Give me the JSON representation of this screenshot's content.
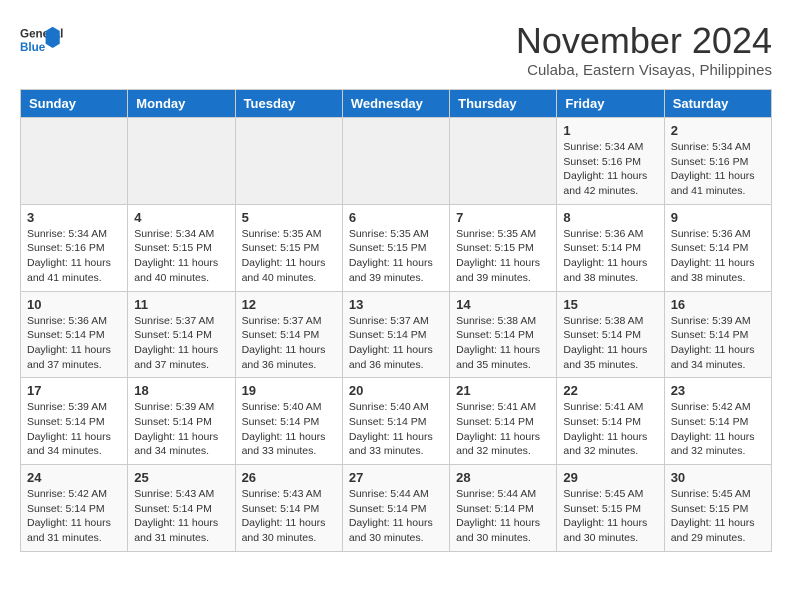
{
  "logo": {
    "line1": "General",
    "line2": "Blue"
  },
  "title": "November 2024",
  "location": "Culaba, Eastern Visayas, Philippines",
  "weekdays": [
    "Sunday",
    "Monday",
    "Tuesday",
    "Wednesday",
    "Thursday",
    "Friday",
    "Saturday"
  ],
  "weeks": [
    [
      {
        "day": "",
        "info": ""
      },
      {
        "day": "",
        "info": ""
      },
      {
        "day": "",
        "info": ""
      },
      {
        "day": "",
        "info": ""
      },
      {
        "day": "",
        "info": ""
      },
      {
        "day": "1",
        "info": "Sunrise: 5:34 AM\nSunset: 5:16 PM\nDaylight: 11 hours\nand 42 minutes."
      },
      {
        "day": "2",
        "info": "Sunrise: 5:34 AM\nSunset: 5:16 PM\nDaylight: 11 hours\nand 41 minutes."
      }
    ],
    [
      {
        "day": "3",
        "info": "Sunrise: 5:34 AM\nSunset: 5:16 PM\nDaylight: 11 hours\nand 41 minutes."
      },
      {
        "day": "4",
        "info": "Sunrise: 5:34 AM\nSunset: 5:15 PM\nDaylight: 11 hours\nand 40 minutes."
      },
      {
        "day": "5",
        "info": "Sunrise: 5:35 AM\nSunset: 5:15 PM\nDaylight: 11 hours\nand 40 minutes."
      },
      {
        "day": "6",
        "info": "Sunrise: 5:35 AM\nSunset: 5:15 PM\nDaylight: 11 hours\nand 39 minutes."
      },
      {
        "day": "7",
        "info": "Sunrise: 5:35 AM\nSunset: 5:15 PM\nDaylight: 11 hours\nand 39 minutes."
      },
      {
        "day": "8",
        "info": "Sunrise: 5:36 AM\nSunset: 5:14 PM\nDaylight: 11 hours\nand 38 minutes."
      },
      {
        "day": "9",
        "info": "Sunrise: 5:36 AM\nSunset: 5:14 PM\nDaylight: 11 hours\nand 38 minutes."
      }
    ],
    [
      {
        "day": "10",
        "info": "Sunrise: 5:36 AM\nSunset: 5:14 PM\nDaylight: 11 hours\nand 37 minutes."
      },
      {
        "day": "11",
        "info": "Sunrise: 5:37 AM\nSunset: 5:14 PM\nDaylight: 11 hours\nand 37 minutes."
      },
      {
        "day": "12",
        "info": "Sunrise: 5:37 AM\nSunset: 5:14 PM\nDaylight: 11 hours\nand 36 minutes."
      },
      {
        "day": "13",
        "info": "Sunrise: 5:37 AM\nSunset: 5:14 PM\nDaylight: 11 hours\nand 36 minutes."
      },
      {
        "day": "14",
        "info": "Sunrise: 5:38 AM\nSunset: 5:14 PM\nDaylight: 11 hours\nand 35 minutes."
      },
      {
        "day": "15",
        "info": "Sunrise: 5:38 AM\nSunset: 5:14 PM\nDaylight: 11 hours\nand 35 minutes."
      },
      {
        "day": "16",
        "info": "Sunrise: 5:39 AM\nSunset: 5:14 PM\nDaylight: 11 hours\nand 34 minutes."
      }
    ],
    [
      {
        "day": "17",
        "info": "Sunrise: 5:39 AM\nSunset: 5:14 PM\nDaylight: 11 hours\nand 34 minutes."
      },
      {
        "day": "18",
        "info": "Sunrise: 5:39 AM\nSunset: 5:14 PM\nDaylight: 11 hours\nand 34 minutes."
      },
      {
        "day": "19",
        "info": "Sunrise: 5:40 AM\nSunset: 5:14 PM\nDaylight: 11 hours\nand 33 minutes."
      },
      {
        "day": "20",
        "info": "Sunrise: 5:40 AM\nSunset: 5:14 PM\nDaylight: 11 hours\nand 33 minutes."
      },
      {
        "day": "21",
        "info": "Sunrise: 5:41 AM\nSunset: 5:14 PM\nDaylight: 11 hours\nand 32 minutes."
      },
      {
        "day": "22",
        "info": "Sunrise: 5:41 AM\nSunset: 5:14 PM\nDaylight: 11 hours\nand 32 minutes."
      },
      {
        "day": "23",
        "info": "Sunrise: 5:42 AM\nSunset: 5:14 PM\nDaylight: 11 hours\nand 32 minutes."
      }
    ],
    [
      {
        "day": "24",
        "info": "Sunrise: 5:42 AM\nSunset: 5:14 PM\nDaylight: 11 hours\nand 31 minutes."
      },
      {
        "day": "25",
        "info": "Sunrise: 5:43 AM\nSunset: 5:14 PM\nDaylight: 11 hours\nand 31 minutes."
      },
      {
        "day": "26",
        "info": "Sunrise: 5:43 AM\nSunset: 5:14 PM\nDaylight: 11 hours\nand 30 minutes."
      },
      {
        "day": "27",
        "info": "Sunrise: 5:44 AM\nSunset: 5:14 PM\nDaylight: 11 hours\nand 30 minutes."
      },
      {
        "day": "28",
        "info": "Sunrise: 5:44 AM\nSunset: 5:14 PM\nDaylight: 11 hours\nand 30 minutes."
      },
      {
        "day": "29",
        "info": "Sunrise: 5:45 AM\nSunset: 5:15 PM\nDaylight: 11 hours\nand 30 minutes."
      },
      {
        "day": "30",
        "info": "Sunrise: 5:45 AM\nSunset: 5:15 PM\nDaylight: 11 hours\nand 29 minutes."
      }
    ]
  ]
}
